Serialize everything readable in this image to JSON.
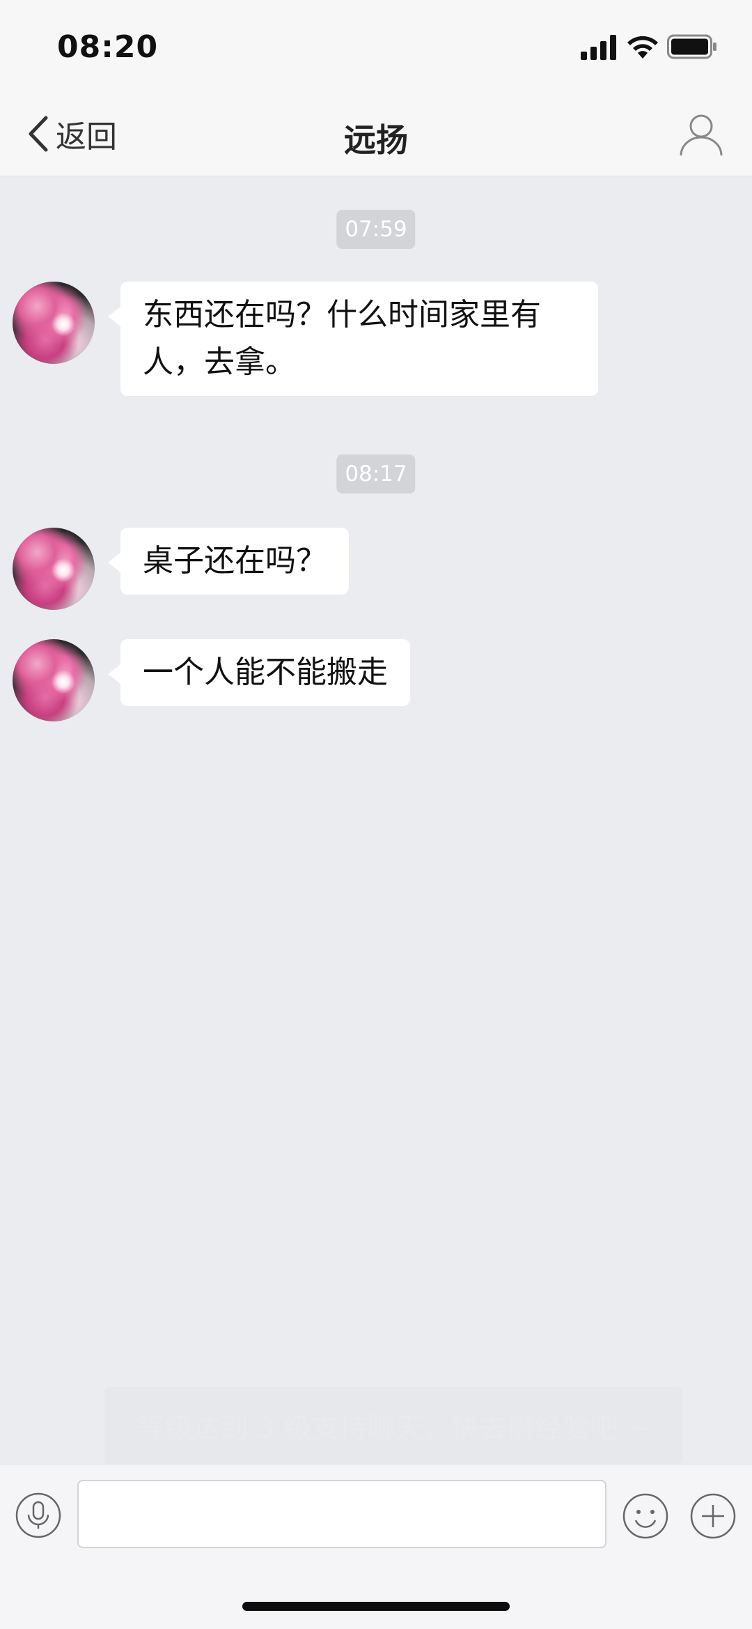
{
  "status_bar": {
    "time": "08:20",
    "icons": [
      "signal-icon",
      "wifi-icon",
      "battery-icon"
    ]
  },
  "nav": {
    "back_label": "返回",
    "title": "远扬",
    "icons": [
      "chevron-left-icon",
      "user-icon"
    ]
  },
  "messages": [
    {
      "timestamp": "07:59"
    },
    {
      "sender": "远扬",
      "text_lines": [
        "东西还在吗？什么时间家里有",
        "人，去拿。"
      ]
    },
    {
      "timestamp": "08:17"
    },
    {
      "sender": "远扬",
      "text_lines": [
        "桌子还在吗？"
      ]
    },
    {
      "sender": "远扬",
      "text_lines": [
        "一个人能不能搬走"
      ]
    }
  ],
  "notice": "等级达到 3 级支持聊天，快去攒经验吧 ~",
  "input_bar": {
    "input_value": "",
    "icons": [
      "microphone-icon",
      "smiley-icon",
      "plus-icon"
    ]
  },
  "colors": {
    "background": "#ebecf0",
    "bubble": "#ffffff",
    "timestamp_bg": "#d2d4d8",
    "bar": "#f7f7f7"
  }
}
